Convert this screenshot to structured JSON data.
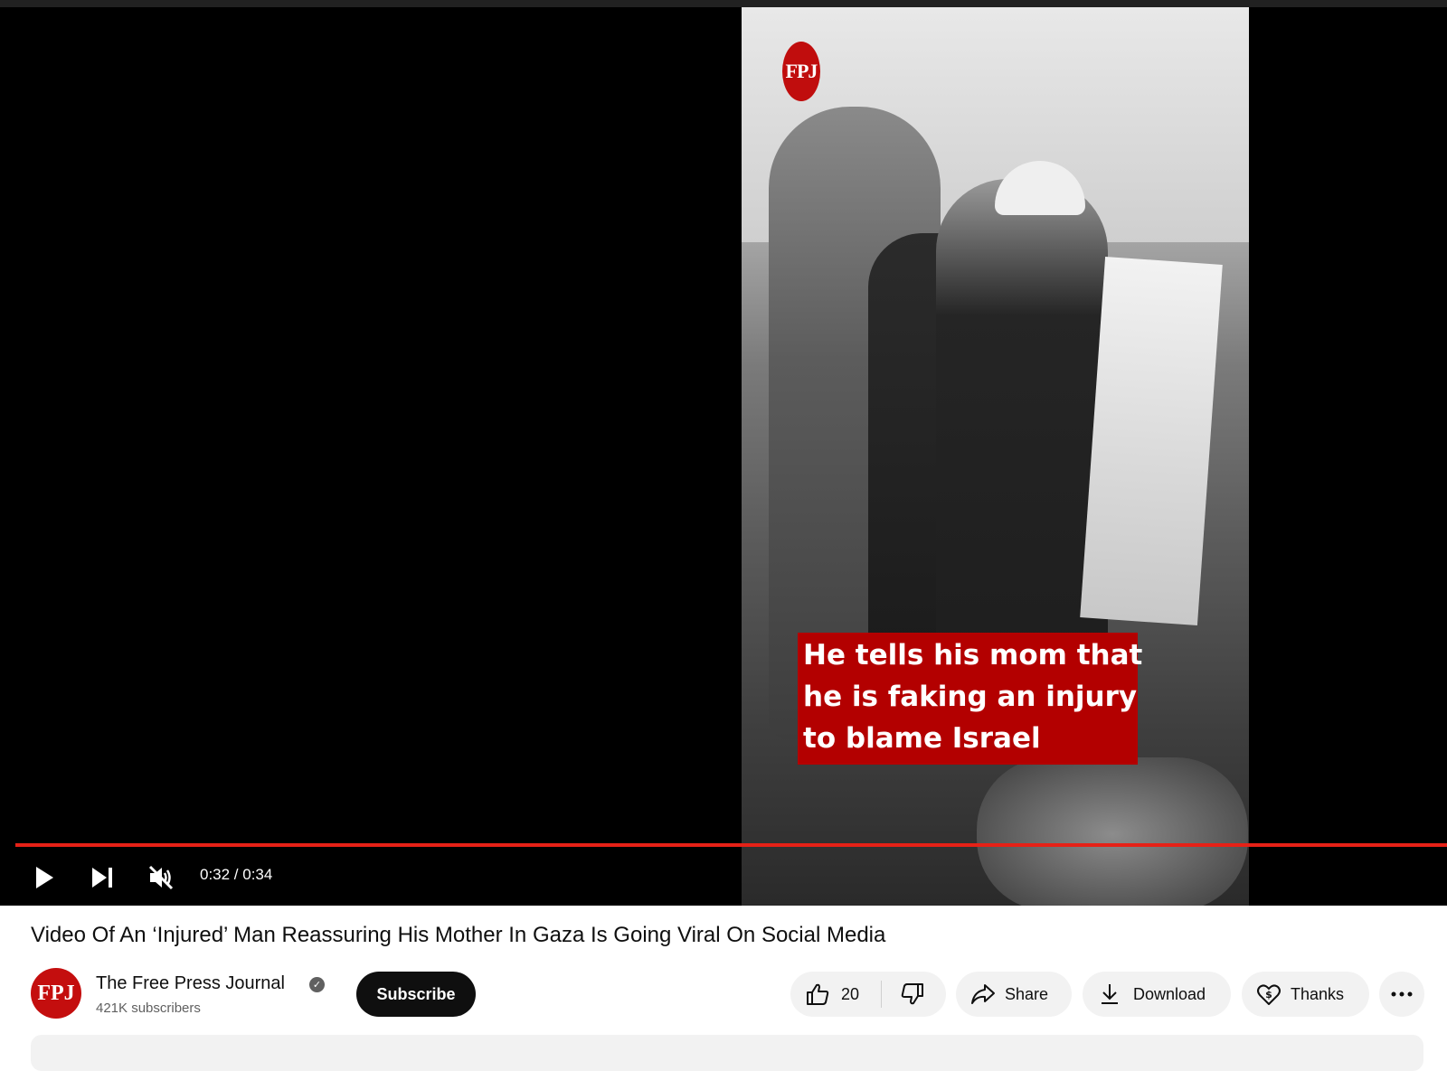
{
  "player": {
    "overlay_caption": [
      "He tells his mom that",
      "he is faking an injury",
      "to blame Israel"
    ],
    "watermark": "FPJ",
    "time_current": "0:32",
    "time_total": "0:34",
    "timecode": "0:32 / 0:34",
    "progress": 0.94,
    "muted": true,
    "accent_color": "#e62117"
  },
  "video": {
    "title": "Video Of An ‘Injured’ Man Reassuring His Mother In Gaza Is Going Viral On Social Media"
  },
  "channel": {
    "avatar_text": "FPJ",
    "name": "The Free Press Journal",
    "verified": true,
    "subscribers": "421K subscribers",
    "subscribe_label": "Subscribe",
    "brand_color": "#c40e0e"
  },
  "actions": {
    "like_count": "20",
    "share_label": "Share",
    "download_label": "Download",
    "thanks_label": "Thanks"
  },
  "icons": [
    "play-icon",
    "next-icon",
    "muted-volume-icon",
    "thumbs-up-icon",
    "thumbs-down-icon",
    "share-icon",
    "download-icon",
    "thanks-icon",
    "more-icon",
    "verified-icon"
  ]
}
